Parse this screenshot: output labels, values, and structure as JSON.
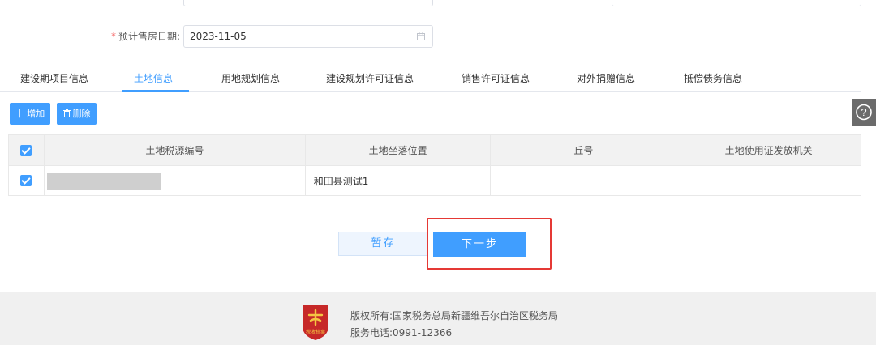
{
  "form": {
    "required_mark": "*",
    "sale_date_label": "预计售房日期:",
    "sale_date_value": "2023-11-05"
  },
  "tabs": [
    {
      "label": "建设期项目信息"
    },
    {
      "label": "土地信息"
    },
    {
      "label": "用地规划信息"
    },
    {
      "label": "建设规划许可证信息"
    },
    {
      "label": "销售许可证信息"
    },
    {
      "label": "对外捐赠信息"
    },
    {
      "label": "抵偿债务信息"
    }
  ],
  "active_tab": "土地信息",
  "toolbar": {
    "add_label": "十 增加",
    "delete_label": "删除"
  },
  "table": {
    "headers": [
      "土地税源编号",
      "土地坐落位置",
      "丘号",
      "土地使用证发放机关"
    ],
    "rows": [
      {
        "checked": true,
        "tax_source_no": "",
        "location": "和田县测试1",
        "lot_no": "",
        "issuing_authority": ""
      }
    ]
  },
  "actions": {
    "save_label": "暂存",
    "next_label": "下一步"
  },
  "footer": {
    "logo_text": "税收档案",
    "copyright": "版权所有:国家税务总局新疆维吾尔自治区税务局",
    "phone": "服务电话:0991-12366"
  },
  "colors": {
    "accent": "#409eff",
    "required": "#f56c6c",
    "highlight": "#e53935",
    "logo": "#c62828"
  },
  "icons": [
    "calendar-icon",
    "add-icon",
    "trash-icon",
    "help-icon",
    "check-icon",
    "tax-emblem-logo"
  ]
}
